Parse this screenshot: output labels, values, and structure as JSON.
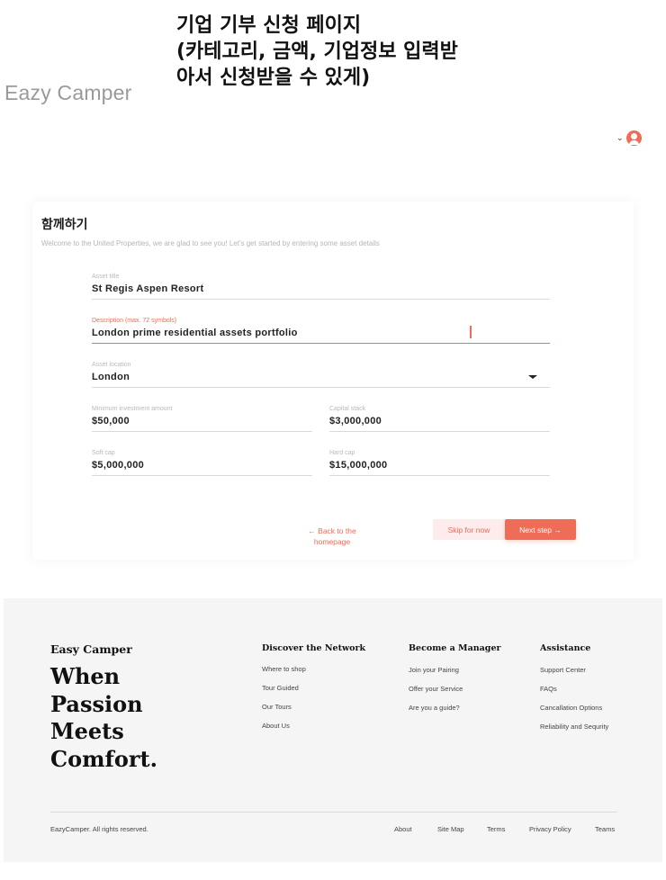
{
  "header": {
    "logo": "Eazy Camper",
    "annotation_lines": [
      "기업 기부 신청 페이지",
      "(카테고리, 금액, 기업정보 입력받",
      "아서 신청받을 수 있게)"
    ]
  },
  "form": {
    "title": "함께하기",
    "subtitle": "Welcome to the United Properties, we are glad to see you! Let's get started by entering some asset details",
    "asset_title": {
      "label": "Asset title",
      "value": "St Regis Aspen Resort"
    },
    "description": {
      "label": "Description (max. 72 symbols)",
      "value": "London prime residential assets portfolio"
    },
    "asset_location": {
      "label": "Asset location",
      "value": "London"
    },
    "min_investment": {
      "label": "Minimum investment amount",
      "value": "$50,000"
    },
    "capital_stack": {
      "label": "Capital stack",
      "value": "$3,000,000"
    },
    "soft_cap": {
      "label": "Soft cap",
      "value": "$5,000,000"
    },
    "hard_cap": {
      "label": "Hard cap",
      "value": "$15,000,000"
    },
    "back_line1": "← Back to the",
    "back_line2": "homepage",
    "skip_label": "Skip for now",
    "next_label": "Next step →"
  },
  "footer": {
    "brand": "Easy Camper",
    "slogan_lines": [
      "When",
      "Passion",
      "Meets",
      "Comfort."
    ],
    "columns": [
      {
        "title": "Discover the Network",
        "links": [
          "Where to shop",
          "Tour Guided",
          "Our Tours",
          "About Us"
        ]
      },
      {
        "title": "Become a Manager",
        "links": [
          "Join your Pairing",
          "Offer your Service",
          "Are you a guide?"
        ]
      },
      {
        "title": "Assistance",
        "links": [
          "Support Center",
          "FAQs",
          "Cancallation Options",
          "Reliability and Sequrity"
        ]
      }
    ],
    "copyright": "EazyCamper. All rights reserved.",
    "bottom_links": [
      "About",
      "Site Map",
      "Terms",
      "Privacy Policy",
      "Teams"
    ]
  },
  "colors": {
    "accent": "#ef6c57",
    "footer_bg": "#f5f5f5"
  },
  "icons": {
    "user_menu": "chevron-down-icon",
    "avatar": "user-avatar-icon",
    "location_dropdown": "caret-down-icon"
  }
}
